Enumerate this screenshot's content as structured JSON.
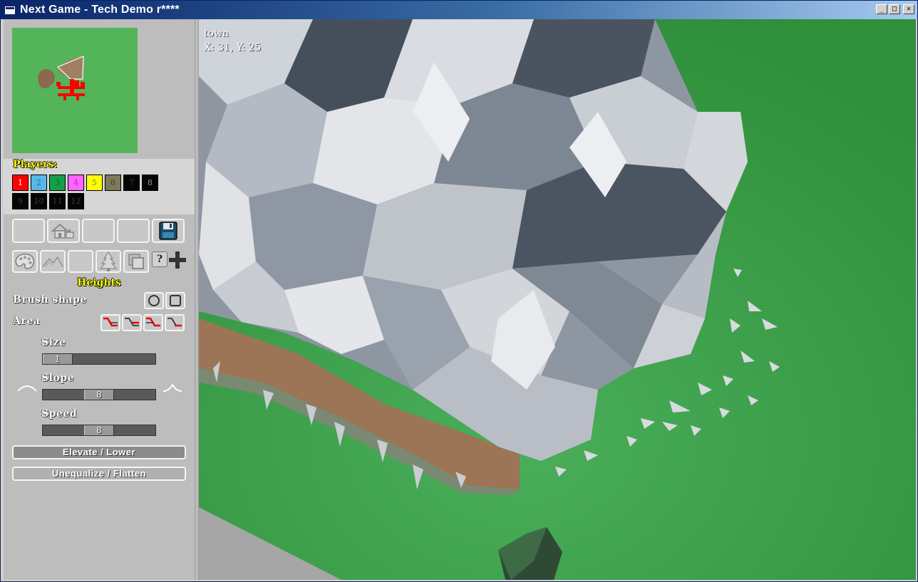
{
  "window": {
    "title": "Next Game - Tech Demo r****",
    "buttons": {
      "minimize": "_",
      "maximize": "□",
      "close": "✕"
    }
  },
  "players": {
    "label": "Players:",
    "swatches": [
      {
        "num": "1",
        "color": "#ff0000",
        "text": "#ffffff"
      },
      {
        "num": "2",
        "color": "#55b8e8",
        "text": "#2a6aa0"
      },
      {
        "num": "3",
        "color": "#14a048",
        "text": "#0a5a22"
      },
      {
        "num": "4",
        "color": "#ff66ff",
        "text": "#b030b0"
      },
      {
        "num": "5",
        "color": "#ffff00",
        "text": "#8a8a00"
      },
      {
        "num": "6",
        "color": "#7c7a5a",
        "text": "#3c3a2a"
      },
      {
        "num": "7",
        "color": "#050505",
        "text": "#3a3a3a"
      },
      {
        "num": "8",
        "color": "#050505",
        "text": "#9a9a9a"
      },
      {
        "num": "9",
        "color": "#050505",
        "text": "#3a3a3a"
      },
      {
        "num": "10",
        "color": "#050505",
        "text": "#3a3a3a"
      },
      {
        "num": "11",
        "color": "#050505",
        "text": "#3a3a3a"
      },
      {
        "num": "12",
        "color": "#050505",
        "text": "#3a3a3a"
      }
    ]
  },
  "toolbar": {
    "row1": [
      "empty-tool",
      "building-icon",
      "empty-tool",
      "empty-tool",
      "save-icon"
    ],
    "row2": [
      "palette-icon",
      "mountains-icon",
      "empty-tool",
      "tree-icon",
      "copy-icon"
    ],
    "help": "?"
  },
  "heights": {
    "title": "Heights",
    "brush_shape": "Brush shape",
    "area": "Area",
    "size": {
      "label": "Size",
      "value": "1",
      "fraction": 0.0
    },
    "slope": {
      "label": "Slope",
      "value": "8",
      "fraction": 0.5
    },
    "speed": {
      "label": "Speed",
      "value": "8",
      "fraction": 0.5
    },
    "elevate_button": "Elevate / Lower",
    "flatten_button": "Unequalize / Flatten"
  },
  "viewport": {
    "terrain_name": "town",
    "coords": "X: 31, Y: 25"
  }
}
